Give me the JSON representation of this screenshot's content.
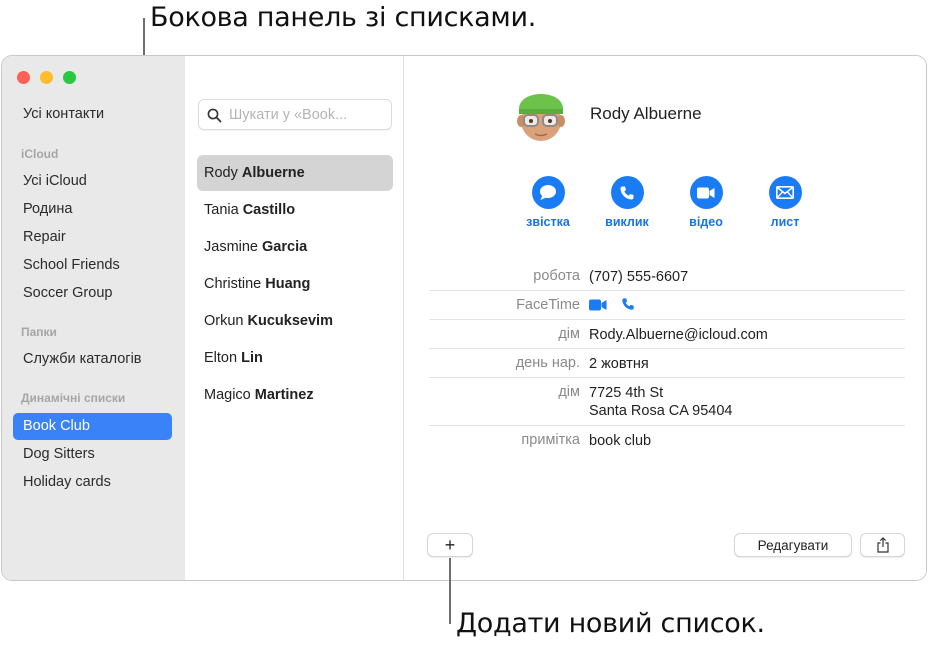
{
  "callouts": {
    "sidebar": "Бокова панель зі списками.",
    "add_list": "Додати новий список."
  },
  "sidebar": {
    "all_contacts": "Усі контакти",
    "groups": [
      {
        "header": "iCloud",
        "items": [
          "Усі iCloud",
          "Родина",
          "Repair",
          "School Friends",
          "Soccer Group"
        ]
      },
      {
        "header": "Папки",
        "items": [
          "Служби каталогів"
        ]
      },
      {
        "header": "Динамічні списки",
        "items": [
          "Book Club",
          "Dog Sitters",
          "Holiday cards"
        ]
      }
    ],
    "selected": "Book Club",
    "accent_color": "#3a82f7"
  },
  "contact_list": {
    "search_placeholder": "Шукати у «Book...",
    "contacts": [
      {
        "first": "Rody",
        "last": "Albuerne",
        "selected": true
      },
      {
        "first": "Tania",
        "last": "Castillo"
      },
      {
        "first": "Jasmine",
        "last": "Garcia"
      },
      {
        "first": "Christine",
        "last": "Huang"
      },
      {
        "first": "Orkun",
        "last": "Kucuksevim"
      },
      {
        "first": "Elton",
        "last": "Lin"
      },
      {
        "first": "Magico",
        "last": "Martinez"
      }
    ]
  },
  "card": {
    "name": "Rody Albuerne",
    "actions": [
      {
        "icon": "message-icon",
        "label": "звістка"
      },
      {
        "icon": "phone-icon",
        "label": "виклик"
      },
      {
        "icon": "video-icon",
        "label": "відео"
      },
      {
        "icon": "mail-icon",
        "label": "лист"
      }
    ],
    "fields": [
      {
        "key": "робота",
        "value": "(707) 555-6607"
      },
      {
        "key": "FaceTime",
        "value": ""
      },
      {
        "key": "дім",
        "value": "Rody.Albuerne@icloud.com"
      },
      {
        "key": "день нар.",
        "value": "2 жовтня"
      },
      {
        "key": "дім",
        "value": "7725 4th St",
        "value2": "Santa Rosa CA 95404"
      },
      {
        "key": "примітка",
        "value": "book club"
      }
    ],
    "accent_color": "#1a7cf5"
  },
  "toolbar": {
    "add_label": "+",
    "edit_label": "Редагувати"
  }
}
